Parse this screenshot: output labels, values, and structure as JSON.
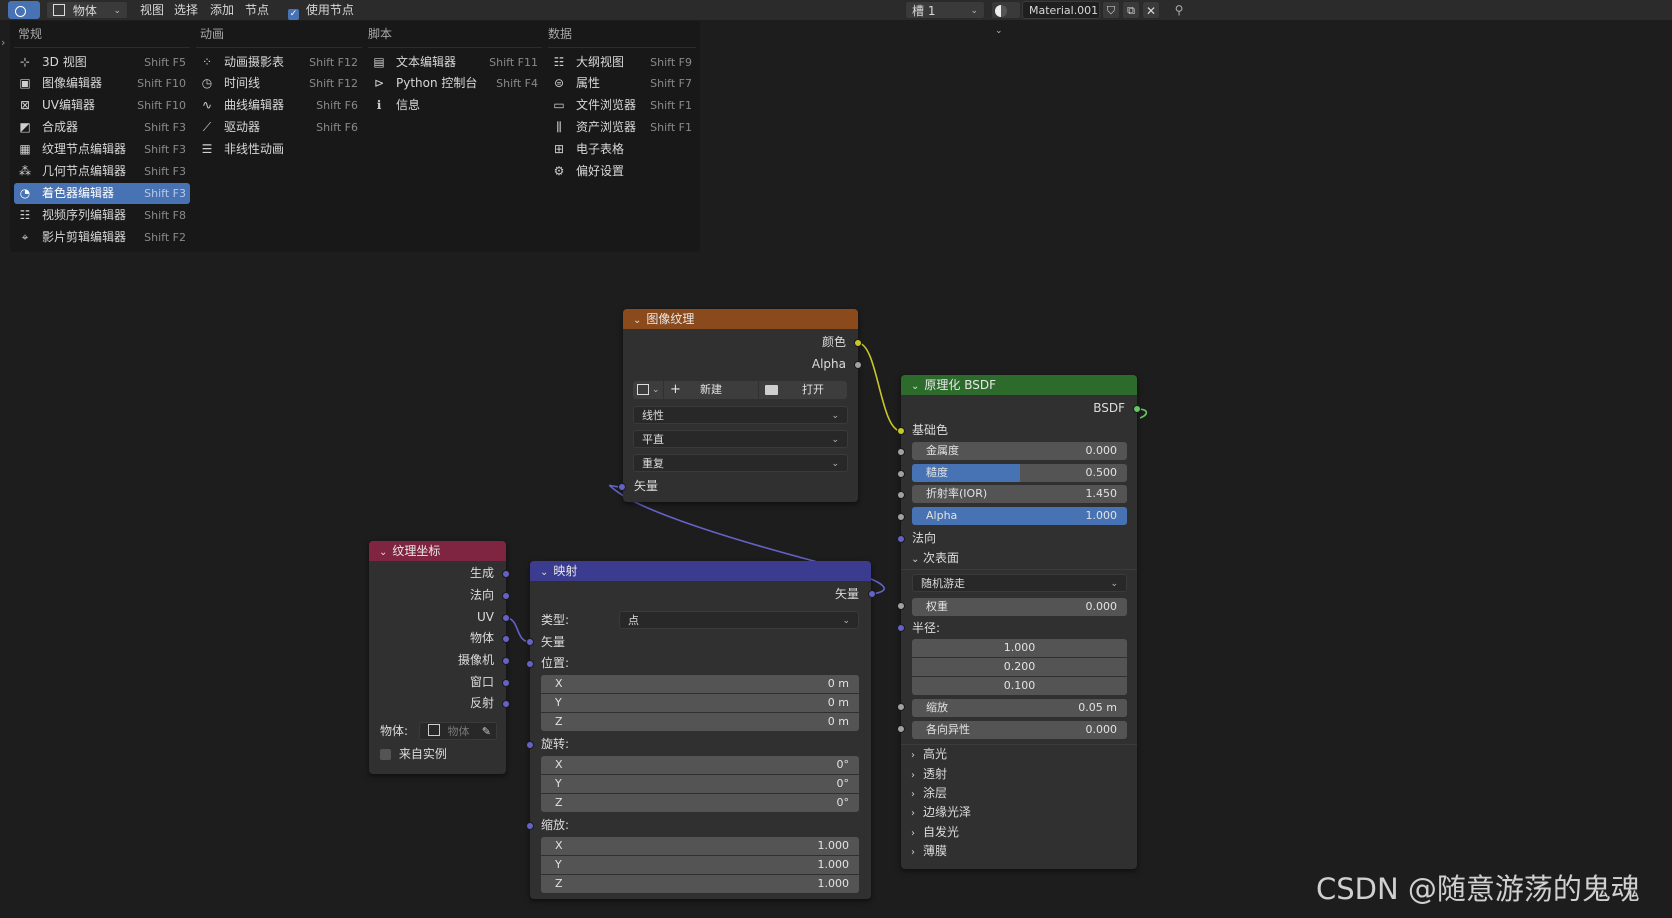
{
  "header": {
    "object_mode": "物体",
    "menus": [
      "视图",
      "选择",
      "添加",
      "节点"
    ],
    "use_nodes_label": "使用节点",
    "slot": "槽 1",
    "material_name": "Material.001"
  },
  "editor_menu": {
    "columns": [
      {
        "title": "常规",
        "items": [
          {
            "label": "3D 视图",
            "shortcut": "Shift F5",
            "icon": "3d-view-icon"
          },
          {
            "label": "图像编辑器",
            "shortcut": "Shift F10",
            "icon": "image-editor-icon"
          },
          {
            "label": "UV编辑器",
            "shortcut": "Shift F10",
            "icon": "uv-editor-icon"
          },
          {
            "label": "合成器",
            "shortcut": "Shift F3",
            "icon": "compositor-icon"
          },
          {
            "label": "纹理节点编辑器",
            "shortcut": "Shift F3",
            "icon": "texture-node-icon"
          },
          {
            "label": "几何节点编辑器",
            "shortcut": "Shift F3",
            "icon": "geometry-node-icon"
          },
          {
            "label": "着色器编辑器",
            "shortcut": "Shift F3",
            "icon": "shader-editor-icon",
            "selected": true
          },
          {
            "label": "视频序列编辑器",
            "shortcut": "Shift F8",
            "icon": "sequencer-icon"
          },
          {
            "label": "影片剪辑编辑器",
            "shortcut": "Shift F2",
            "icon": "movie-clip-icon"
          }
        ]
      },
      {
        "title": "动画",
        "items": [
          {
            "label": "动画摄影表",
            "shortcut": "Shift F12",
            "icon": "dopesheet-icon"
          },
          {
            "label": "时间线",
            "shortcut": "Shift F12",
            "icon": "timeline-icon"
          },
          {
            "label": "曲线编辑器",
            "shortcut": "Shift F6",
            "icon": "graph-editor-icon"
          },
          {
            "label": "驱动器",
            "shortcut": "Shift F6",
            "icon": "drivers-icon"
          },
          {
            "label": "非线性动画",
            "shortcut": "",
            "icon": "nla-icon"
          }
        ]
      },
      {
        "title": "脚本",
        "items": [
          {
            "label": "文本编辑器",
            "shortcut": "Shift F11",
            "icon": "text-editor-icon"
          },
          {
            "label": "Python 控制台",
            "shortcut": "Shift F4",
            "icon": "console-icon"
          },
          {
            "label": "信息",
            "shortcut": "",
            "icon": "info-icon"
          }
        ]
      },
      {
        "title": "数据",
        "items": [
          {
            "label": "大纲视图",
            "shortcut": "Shift F9",
            "icon": "outliner-icon"
          },
          {
            "label": "属性",
            "shortcut": "Shift F7",
            "icon": "properties-icon"
          },
          {
            "label": "文件浏览器",
            "shortcut": "Shift F1",
            "icon": "file-browser-icon"
          },
          {
            "label": "资产浏览器",
            "shortcut": "Shift F1",
            "icon": "asset-browser-icon"
          },
          {
            "label": "电子表格",
            "shortcut": "",
            "icon": "spreadsheet-icon"
          },
          {
            "label": "偏好设置",
            "shortcut": "",
            "icon": "preferences-icon"
          }
        ]
      }
    ]
  },
  "image_texture": {
    "title": "图像纹理",
    "out_color": "颜色",
    "out_alpha": "Alpha",
    "new_label": "新建",
    "open_label": "打开",
    "interpolation": "线性",
    "projection": "平直",
    "extension": "重复",
    "in_vector": "矢量"
  },
  "tex_coord": {
    "title": "纹理坐标",
    "outputs": [
      "生成",
      "法向",
      "UV",
      "物体",
      "摄像机",
      "窗口",
      "反射"
    ],
    "object_label": "物体:",
    "object_placeholder": "物体",
    "from_instancer": "来自实例"
  },
  "mapping": {
    "title": "映射",
    "out_vector": "矢量",
    "type_label": "类型:",
    "type_value": "点",
    "in_vector": "矢量",
    "location_label": "位置:",
    "location": [
      {
        "axis": "X",
        "value": "0 m"
      },
      {
        "axis": "Y",
        "value": "0 m"
      },
      {
        "axis": "Z",
        "value": "0 m"
      }
    ],
    "rotation_label": "旋转:",
    "rotation": [
      {
        "axis": "X",
        "value": "0°"
      },
      {
        "axis": "Y",
        "value": "0°"
      },
      {
        "axis": "Z",
        "value": "0°"
      }
    ],
    "scale_label": "缩放:",
    "scale": [
      {
        "axis": "X",
        "value": "1.000"
      },
      {
        "axis": "Y",
        "value": "1.000"
      },
      {
        "axis": "Z",
        "value": "1.000"
      }
    ]
  },
  "bsdf": {
    "title": "原理化 BSDF",
    "out_bsdf": "BSDF",
    "base_color": "基础色",
    "metallic": {
      "label": "金属度",
      "value": "0.000"
    },
    "roughness": {
      "label": "糙度",
      "value": "0.500",
      "fill": 0.5
    },
    "ior": {
      "label": "折射率(IOR)",
      "value": "1.450"
    },
    "alpha": {
      "label": "Alpha",
      "value": "1.000",
      "fill": 1.0
    },
    "normal": "法向",
    "subsurface": "次表面",
    "subsurface_method": "随机游走",
    "weight": {
      "label": "权重",
      "value": "0.000"
    },
    "radius_label": "半径:",
    "radius": [
      "1.000",
      "0.200",
      "0.100"
    ],
    "scale": {
      "label": "缩放",
      "value": "0.05 m"
    },
    "anisotropy": {
      "label": "各向异性",
      "value": "0.000"
    },
    "panels": [
      "高光",
      "透射",
      "涂层",
      "边缘光泽",
      "自发光",
      "薄膜"
    ]
  },
  "colors": {
    "image_texture_header": "#8a4a1c",
    "tex_coord_header": "#7f2542",
    "mapping_header": "#3b3b8f",
    "bsdf_header": "#2d6b2d",
    "selection": "#4772b3"
  },
  "watermark": "CSDN @随意游荡的鬼魂"
}
